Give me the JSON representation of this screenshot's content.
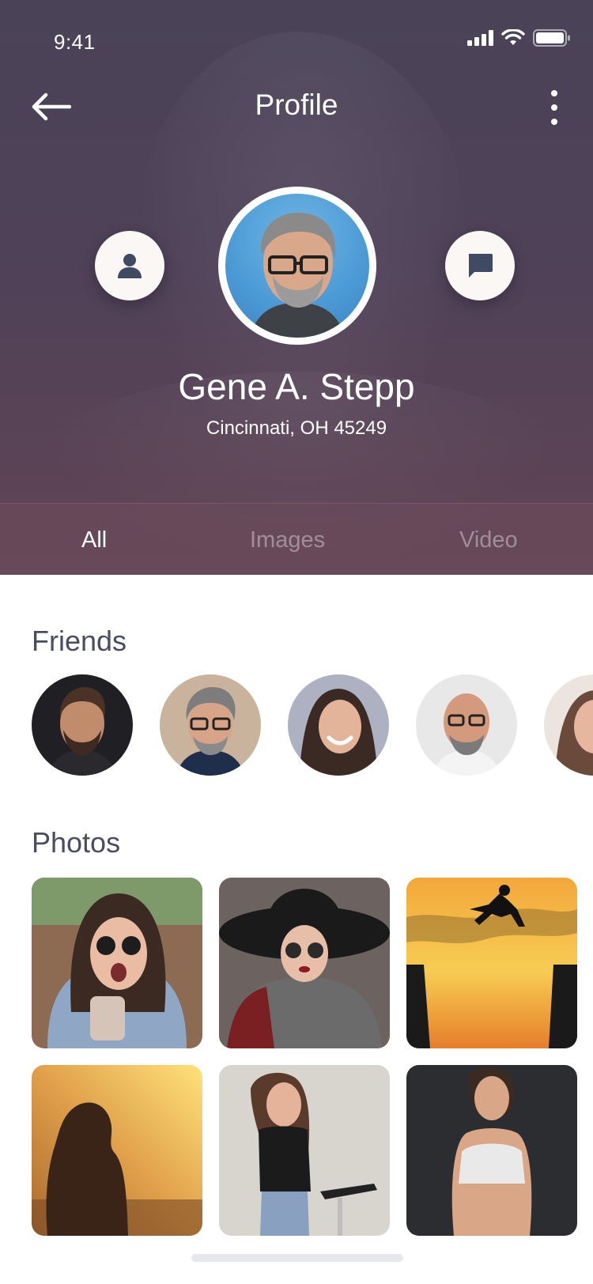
{
  "status_bar": {
    "time": "9:41"
  },
  "nav": {
    "title": "Profile"
  },
  "profile": {
    "name": "Gene A. Stepp",
    "location": "Cincinnati, OH 45249"
  },
  "tabs": [
    {
      "label": "All",
      "active": true
    },
    {
      "label": "Images",
      "active": false
    },
    {
      "label": "Video",
      "active": false
    }
  ],
  "friends": {
    "title": "Friends"
  },
  "photos": {
    "title": "Photos"
  },
  "colors": {
    "header_top": "#4a4358",
    "header_bottom": "#634555",
    "section_title": "#4a4c62",
    "button_bg": "#faf7f4",
    "button_icon": "#414a63"
  }
}
